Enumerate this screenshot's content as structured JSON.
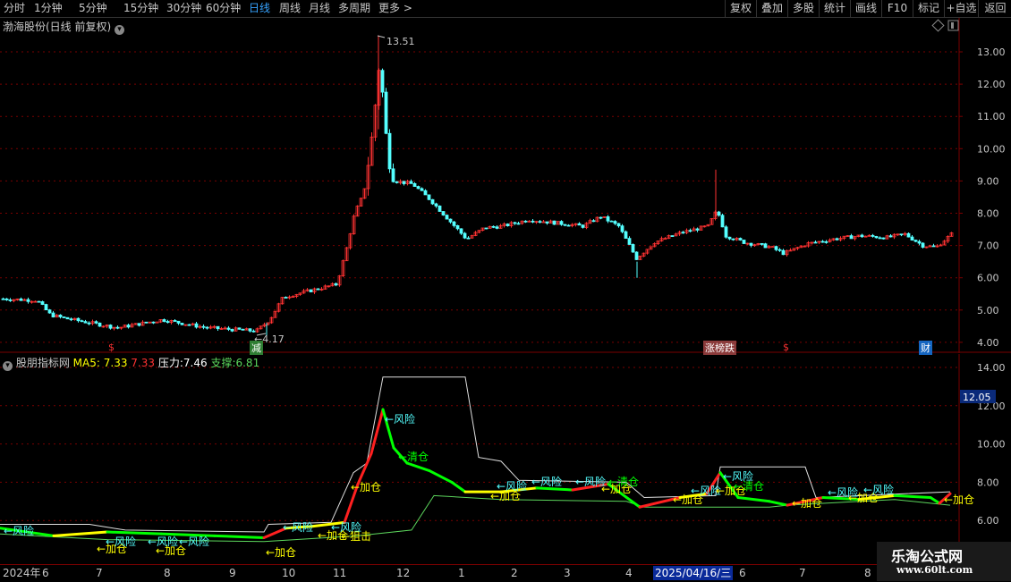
{
  "toolbar": {
    "periods": [
      "分时",
      "1分钟",
      "5分钟",
      "15分钟",
      "30分钟",
      "60分钟",
      "日线",
      "周线",
      "月线",
      "多周期",
      "更多 >"
    ],
    "active_period": "日线",
    "right_buttons": [
      "复权",
      "叠加",
      "多股",
      "统计",
      "画线",
      "F10",
      "标记",
      "+自选",
      "返回"
    ]
  },
  "main": {
    "title": "渤海股份(日线 前复权)",
    "y_ticks": [
      "13.00",
      "12.00",
      "11.00",
      "10.00",
      "9.00",
      "8.00",
      "7.00",
      "6.00",
      "5.00",
      "4.00"
    ],
    "high_label": "13.51",
    "low_label": "4.17",
    "markers": [
      "$",
      "减",
      "涨榜跌",
      "$",
      "财"
    ]
  },
  "indicator": {
    "name": "股朋指标网",
    "ma_label": "MA5:",
    "ma_val1": "7.33",
    "ma_val2": "7.33",
    "pressure_label": "压力:",
    "pressure_val": "7.46",
    "support_label": "支撑:",
    "support_val": "6.81",
    "y_ticks": [
      "14.00",
      "12.00",
      "10.00",
      "8.00",
      "6.00"
    ],
    "cursor_value": "12.05",
    "annotations": {
      "risk": "风险",
      "add": "加仓",
      "clear": "清仓",
      "snipe": "狙击"
    }
  },
  "xaxis": {
    "year": "2024年",
    "months": [
      "6",
      "7",
      "8",
      "9",
      "10",
      "11",
      "12",
      "1",
      "2",
      "3",
      "4",
      "5",
      "6",
      "7",
      "8"
    ],
    "cursor_date": "2025/04/16/三"
  },
  "watermark": {
    "name": "乐淘公式网",
    "url": "www.60lt.com"
  },
  "colors": {
    "up": "#ff3232",
    "down": "#54ffff",
    "active": "#36a3ff",
    "yellow": "#ffff00",
    "green": "#00ff00",
    "grid": "#7a0000"
  }
}
